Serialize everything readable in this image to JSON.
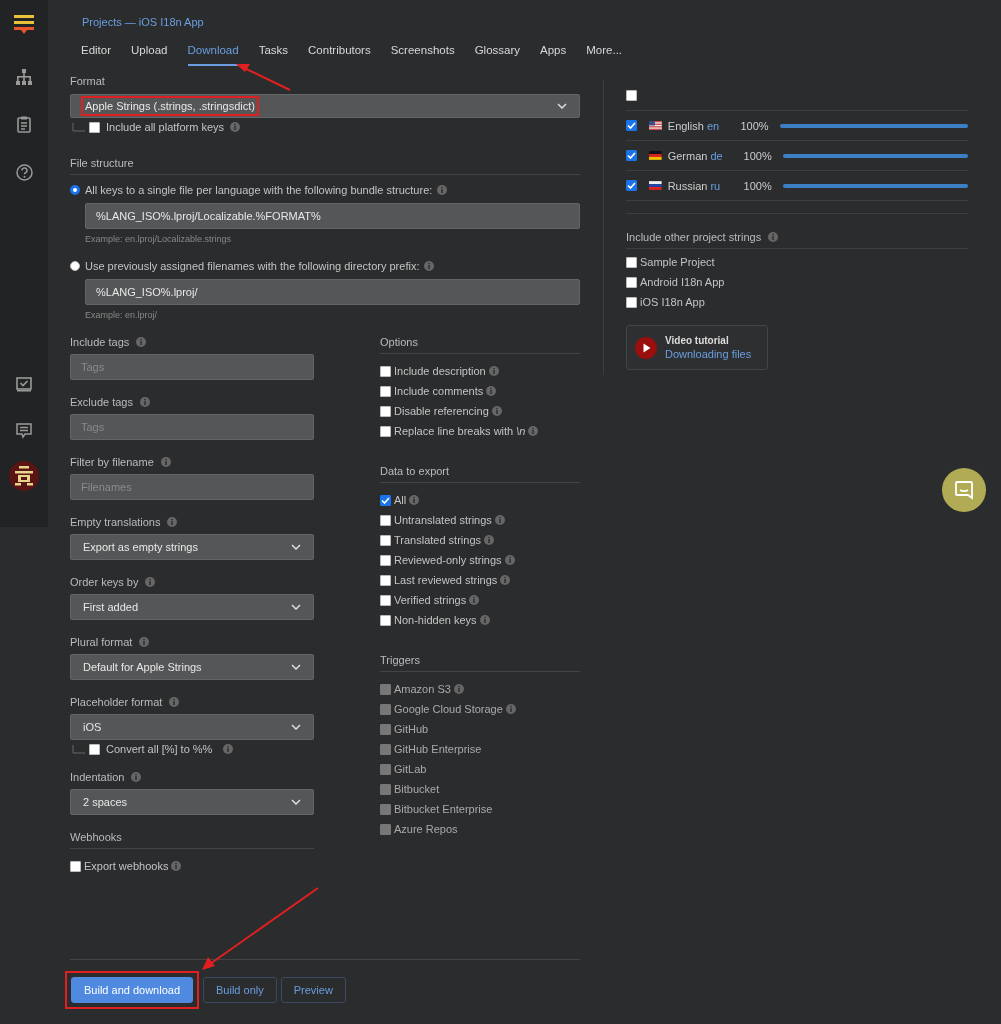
{
  "breadcrumb": "Projects — iOS I18n App",
  "tabs": [
    {
      "label": "Editor",
      "selected": false
    },
    {
      "label": "Upload",
      "selected": false
    },
    {
      "label": "Download",
      "selected": true
    },
    {
      "label": "Tasks",
      "selected": false
    },
    {
      "label": "Contributors",
      "selected": false
    },
    {
      "label": "Screenshots",
      "selected": false
    },
    {
      "label": "Glossary",
      "selected": false
    },
    {
      "label": "Apps",
      "selected": false
    },
    {
      "label": "More...",
      "selected": false
    }
  ],
  "format": {
    "label": "Format",
    "value": "Apple Strings (.strings, .stringsdict)",
    "option": {
      "label": "Include all platform keys",
      "checked": false
    }
  },
  "file_structure": {
    "title": "File structure",
    "choices": [
      {
        "label": "All keys to a single file per language with the following bundle structure:",
        "selected": true,
        "value": "%LANG_ISO%.lproj/Localizable.%FORMAT%",
        "example": "Example: en.lproj/Localizable.strings"
      },
      {
        "label": "Use previously assigned filenames with the following directory prefix:",
        "selected": false,
        "value": "%LANG_ISO%.lproj/",
        "example": "Example: en.lproj/"
      }
    ]
  },
  "fields": [
    {
      "kind": "input",
      "label": "Include tags",
      "placeholder": "Tags"
    },
    {
      "kind": "input",
      "label": "Exclude tags",
      "placeholder": "Tags"
    },
    {
      "kind": "input",
      "label": "Filter by filename",
      "placeholder": "Filenames"
    },
    {
      "kind": "select",
      "label": "Empty translations",
      "value": "Export as empty strings"
    },
    {
      "kind": "select",
      "label": "Order keys by",
      "value": "First added"
    },
    {
      "kind": "select",
      "label": "Plural format",
      "value": "Default for Apple Strings"
    },
    {
      "kind": "select",
      "label": "Placeholder format",
      "value": "iOS",
      "option": {
        "label": "Convert all [%] to %%",
        "checked": false
      }
    },
    {
      "kind": "select",
      "label": "Indentation",
      "value": "2 spaces"
    }
  ],
  "webhooks": {
    "title": "Webhooks",
    "option": {
      "label": "Export webhooks",
      "checked": false
    }
  },
  "options": {
    "title": "Options",
    "items": [
      {
        "label": "Include description",
        "checked": false,
        "info": true
      },
      {
        "label": "Include comments",
        "checked": false,
        "info": true
      },
      {
        "label": "Disable referencing",
        "checked": false,
        "info": true
      },
      {
        "label": "Replace line breaks with *\\n*",
        "checked": false,
        "info": true
      }
    ]
  },
  "data_to_export": {
    "title": "Data to export",
    "items": [
      {
        "label": "All",
        "checked": true,
        "info": true
      },
      {
        "label": "Untranslated strings",
        "checked": false,
        "info": true
      },
      {
        "label": "Translated strings",
        "checked": false,
        "info": true
      },
      {
        "label": "Reviewed-only strings",
        "checked": false,
        "info": true
      },
      {
        "label": "Last reviewed strings",
        "checked": false,
        "info": true
      },
      {
        "label": "Verified strings",
        "checked": false,
        "info": true
      },
      {
        "label": "Non-hidden keys",
        "checked": false,
        "info": true
      }
    ]
  },
  "triggers": {
    "title": "Triggers",
    "items": [
      {
        "label": "Amazon S3",
        "disabled": true,
        "info": true
      },
      {
        "label": "Google Cloud Storage",
        "disabled": true,
        "info": true
      },
      {
        "label": "GitHub",
        "disabled": true,
        "info": false
      },
      {
        "label": "GitHub Enterprise",
        "disabled": true,
        "info": false
      },
      {
        "label": "GitLab",
        "disabled": true,
        "info": false
      },
      {
        "label": "Bitbucket",
        "disabled": true,
        "info": false
      },
      {
        "label": "Bitbucket Enterprise",
        "disabled": true,
        "info": false
      },
      {
        "label": "Azure Repos",
        "disabled": true,
        "info": false
      }
    ]
  },
  "languages": {
    "select_all": {
      "checked": false
    },
    "items": [
      {
        "kind": "us",
        "name": "English",
        "code": "en",
        "checked": true,
        "percent": "100%",
        "level": 1
      },
      {
        "kind": "de",
        "name": "German",
        "code": "de",
        "checked": true,
        "percent": "100%",
        "level": 1
      },
      {
        "kind": "ru",
        "name": "Russian",
        "code": "ru",
        "checked": true,
        "percent": "100%",
        "level": 1
      }
    ]
  },
  "other_projects": {
    "title": "Include other project strings",
    "items": [
      {
        "label": "Sample Project",
        "checked": false
      },
      {
        "label": "Android I18n App",
        "checked": false
      },
      {
        "label": "iOS I18n App",
        "checked": false
      }
    ]
  },
  "video": {
    "title": "Video tutorial",
    "link": "Downloading files"
  },
  "buttons": [
    {
      "label": "Build and download",
      "kind": "primary"
    },
    {
      "label": "Build only",
      "kind": "secondary"
    },
    {
      "label": "Preview",
      "kind": "secondary"
    }
  ]
}
